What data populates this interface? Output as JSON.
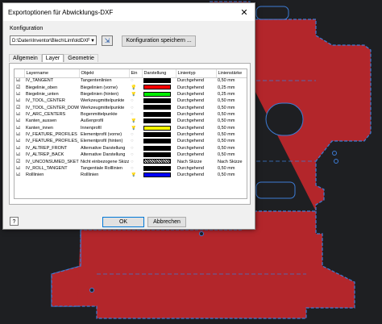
{
  "dialog": {
    "title": "Exportoptionen für Abwicklungs-DXF",
    "close_glyph": "✕",
    "config_label": "Konfiguration",
    "config_value": "D:\\Daten\\Inventor\\Blech\\LimfoldDXF",
    "save_config_label": "Konfiguration speichern ...",
    "tabs": [
      {
        "label": "Allgemein",
        "active": false
      },
      {
        "label": "Layer",
        "active": true
      },
      {
        "label": "Geometrie",
        "active": false
      }
    ],
    "columns": [
      "Layername",
      "Objekt",
      "Ein",
      "Darstellung",
      "Linientyp",
      "Linienstärke"
    ],
    "rows": [
      {
        "checked": true,
        "name": "IV_TANGENT",
        "object": "Tangentenlinien",
        "on": false,
        "color": "#000000",
        "linetype": "Durchgehend",
        "weight": "0,50 mm"
      },
      {
        "checked": true,
        "name": "Biegelinie_oben",
        "object": "Biegelinien (vorne)",
        "on": true,
        "color": "#ff0000",
        "linetype": "Durchgehend",
        "weight": "0,25 mm"
      },
      {
        "checked": true,
        "name": "Biegelinie_unten",
        "object": "Biegelinien (hinten)",
        "on": true,
        "color": "#00ee00",
        "linetype": "Durchgehend",
        "weight": "0,25 mm"
      },
      {
        "checked": true,
        "name": "IV_TOOL_CENTER",
        "object": "Werkzeugmittelpunkte",
        "on": false,
        "color": "#000000",
        "linetype": "Durchgehend",
        "weight": "0,50 mm"
      },
      {
        "checked": true,
        "name": "IV_TOOL_CENTER_DOWN",
        "object": "Werkzeugmittelpunkte",
        "on": false,
        "color": "#000000",
        "linetype": "Durchgehend",
        "weight": "0,50 mm"
      },
      {
        "checked": true,
        "name": "IV_ARC_CENTERS",
        "object": "Bogenmittelpunkte",
        "on": false,
        "color": "#000000",
        "linetype": "Durchgehend",
        "weight": "0,50 mm"
      },
      {
        "checked": true,
        "name": "Kanten_aussen",
        "object": "Außenprofil",
        "on": true,
        "color": "#000000",
        "linetype": "Durchgehend",
        "weight": "0,50 mm"
      },
      {
        "checked": true,
        "name": "Kanten_innen",
        "object": "Innenprofil",
        "on": true,
        "color": "#ffff00",
        "linetype": "Durchgehend",
        "weight": "0,50 mm"
      },
      {
        "checked": true,
        "name": "IV_FEATURE_PROFILES",
        "object": "Elementprofil (vorne)",
        "on": false,
        "color": "#000000",
        "linetype": "Durchgehend",
        "weight": "0,50 mm"
      },
      {
        "checked": true,
        "name": "IV_FEATURE_PROFILES_DOWN",
        "object": "Elementprofil (hinten)",
        "on": false,
        "color": "#000000",
        "linetype": "Durchgehend",
        "weight": "0,50 mm"
      },
      {
        "checked": true,
        "name": "IV_ALTREP_FRONT",
        "object": "Alternative Darstellung",
        "on": false,
        "color": "#000000",
        "linetype": "Durchgehend",
        "weight": "0,50 mm"
      },
      {
        "checked": true,
        "name": "IV_ALTREP_BACK",
        "object": "Alternative Darstellung",
        "on": false,
        "color": "#000000",
        "linetype": "Durchgehend",
        "weight": "0,50 mm"
      },
      {
        "checked": true,
        "name": "IV_UNCONSUMED_SKETCHES",
        "object": "Nicht einbezogene Skizze",
        "on": false,
        "color": "hatch",
        "linetype": "Nach Skizze",
        "weight": "Nach Skizze"
      },
      {
        "checked": true,
        "name": "IV_ROLL_TANGENT",
        "object": "Tangentiale Rolllinien",
        "on": false,
        "color": "#000000",
        "linetype": "Durchgehend",
        "weight": "0,50 mm"
      },
      {
        "checked": true,
        "name": "Rolllinien",
        "object": "Rolllinien",
        "on": true,
        "color": "#0000ff",
        "linetype": "Durchgehend",
        "weight": "0,50 mm"
      }
    ],
    "help_label": "?",
    "ok_label": "OK",
    "cancel_label": "Abbrechen"
  },
  "canvas": {
    "background": "#1e1f22",
    "part_fill": "#b3262b",
    "outline_color": "#3d7cd6"
  }
}
